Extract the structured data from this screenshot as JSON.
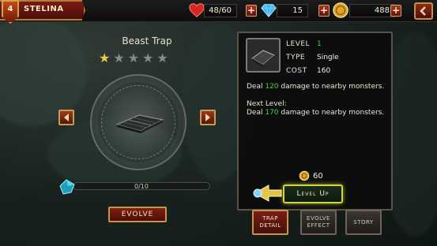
{
  "player": {
    "level": "4",
    "name": "STELINA"
  },
  "resources": {
    "hearts": "48/60",
    "gems": "15",
    "coins": "488"
  },
  "trap": {
    "title": "Beast Trap",
    "stars_filled": 1,
    "stars_total": 5,
    "xp": "0/10",
    "xp_fraction": 0,
    "evolve_label": "Evolve"
  },
  "info": {
    "level_label": "LEVEL",
    "level_value": "1",
    "type_label": "TYPE",
    "type_value": "Single",
    "cost_label": "COST",
    "cost_value": "160",
    "desc_prefix": "Deal ",
    "desc_damage": "120",
    "desc_suffix": " damage to nearby monsters.",
    "next_label": "Next Level:",
    "next_prefix": "Deal ",
    "next_damage": "170",
    "next_suffix": " damage to nearby monsters.",
    "upgrade_cost": "60",
    "levelup_label": "Level Up"
  },
  "tabs": [
    {
      "line1": "Trap",
      "line2": "Detail"
    },
    {
      "line1": "Evolve",
      "line2": "Effect"
    },
    {
      "line1": "Story",
      "line2": ""
    }
  ],
  "colors": {
    "accent_green": "#47d24c",
    "gold": "#f0c64a",
    "brand_red": "#7b1a12"
  }
}
